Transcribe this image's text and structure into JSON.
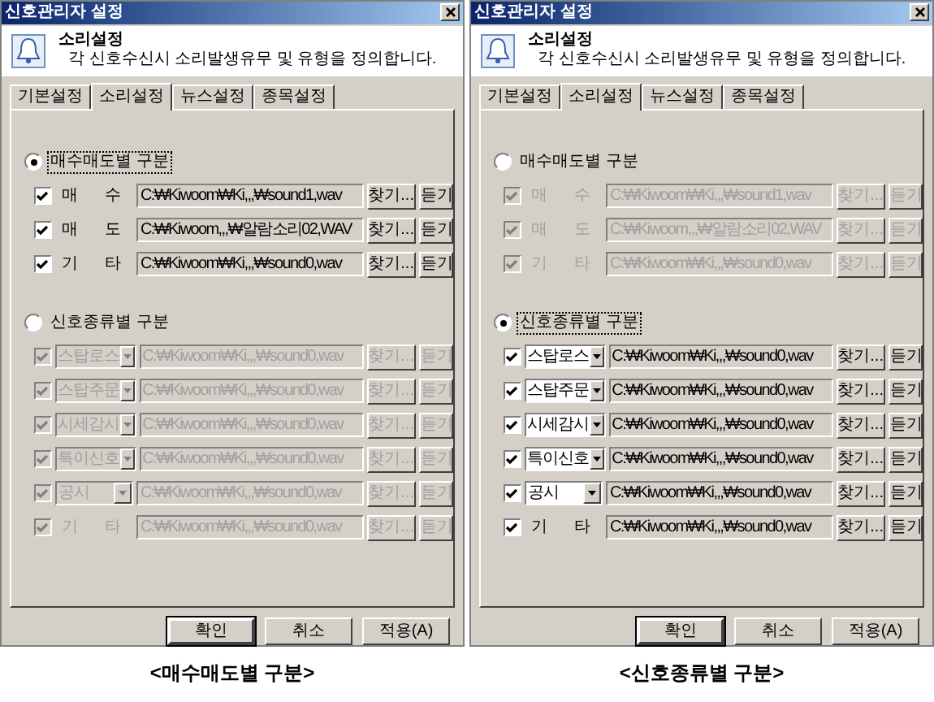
{
  "dialogs": [
    {
      "title": "신호관리자 설정",
      "header": {
        "title": "소리설정",
        "description": "각 신호수신시 소리발생유무 및 유형을 정의합니다."
      },
      "tabs": [
        {
          "label": "기본설정",
          "selected": false
        },
        {
          "label": "소리설정",
          "selected": true
        },
        {
          "label": "뉴스설정",
          "selected": false
        },
        {
          "label": "종목설정",
          "selected": false
        }
      ],
      "groups": [
        {
          "label": "매수매도별 구분",
          "selected": true,
          "rows": [
            {
              "kind": "label",
              "label": "매 수",
              "checked": true,
              "path": "C:₩Kiwoom₩Ki,,,₩sound1,wav",
              "browse": "찾기...",
              "play": "듣기"
            },
            {
              "kind": "label",
              "label": "매 도",
              "checked": true,
              "path": "C:₩Kiwoom,,,₩알람소리02,WAV",
              "browse": "찾기...",
              "play": "듣기"
            },
            {
              "kind": "label",
              "label": "기 타",
              "checked": true,
              "path": "C:₩Kiwoom₩Ki,,,₩sound0,wav",
              "browse": "찾기...",
              "play": "듣기"
            }
          ]
        },
        {
          "label": "신호종류별 구분",
          "selected": false,
          "rows": [
            {
              "kind": "dropdown",
              "label": "스탑로스",
              "checked": true,
              "path": "C:₩Kiwoom₩Ki,,,₩sound0,wav",
              "browse": "찾기...",
              "play": "듣기"
            },
            {
              "kind": "dropdown",
              "label": "스탑주문",
              "checked": true,
              "path": "C:₩Kiwoom₩Ki,,,₩sound0,wav",
              "browse": "찾기...",
              "play": "듣기"
            },
            {
              "kind": "dropdown",
              "label": "시세감시",
              "checked": true,
              "path": "C:₩Kiwoom₩Ki,,,₩sound0,wav",
              "browse": "찾기...",
              "play": "듣기"
            },
            {
              "kind": "dropdown",
              "label": "특이신호",
              "checked": true,
              "path": "C:₩Kiwoom₩Ki,,,₩sound0,wav",
              "browse": "찾기...",
              "play": "듣기"
            },
            {
              "kind": "dropdown",
              "label": "공시",
              "checked": true,
              "path": "C:₩Kiwoom₩Ki,,,₩sound0,wav",
              "browse": "찾기...",
              "play": "듣기"
            },
            {
              "kind": "label",
              "label": "기 타",
              "checked": true,
              "path": "C:₩Kiwoom₩Ki,,,₩sound0,wav",
              "browse": "찾기...",
              "play": "듣기"
            }
          ]
        }
      ],
      "buttons": [
        {
          "label": "확인",
          "default": true
        },
        {
          "label": "취소",
          "default": false
        },
        {
          "label": "적용(A)",
          "default": false
        }
      ],
      "caption": "<매수매도별 구분>"
    },
    {
      "title": "신호관리자 설정",
      "header": {
        "title": "소리설정",
        "description": "각 신호수신시 소리발생유무 및 유형을 정의합니다."
      },
      "tabs": [
        {
          "label": "기본설정",
          "selected": false
        },
        {
          "label": "소리설정",
          "selected": true
        },
        {
          "label": "뉴스설정",
          "selected": false
        },
        {
          "label": "종목설정",
          "selected": false
        }
      ],
      "groups": [
        {
          "label": "매수매도별 구분",
          "selected": false,
          "rows": [
            {
              "kind": "label",
              "label": "매 수",
              "checked": true,
              "path": "C:₩Kiwoom₩Ki,,,₩sound1,wav",
              "browse": "찾기...",
              "play": "듣기"
            },
            {
              "kind": "label",
              "label": "매 도",
              "checked": true,
              "path": "C:₩Kiwoom,,,₩알람소리02,WAV",
              "browse": "찾기...",
              "play": "듣기"
            },
            {
              "kind": "label",
              "label": "기 타",
              "checked": true,
              "path": "C:₩Kiwoom₩Ki,,,₩sound0,wav",
              "browse": "찾기...",
              "play": "듣기"
            }
          ]
        },
        {
          "label": "신호종류별 구분",
          "selected": true,
          "rows": [
            {
              "kind": "dropdown",
              "label": "스탑로스",
              "checked": true,
              "path": "C:₩Kiwoom₩Ki,,,₩sound0,wav",
              "browse": "찾기...",
              "play": "듣기"
            },
            {
              "kind": "dropdown",
              "label": "스탑주문",
              "checked": true,
              "path": "C:₩Kiwoom₩Ki,,,₩sound0,wav",
              "browse": "찾기...",
              "play": "듣기"
            },
            {
              "kind": "dropdown",
              "label": "시세감시",
              "checked": true,
              "path": "C:₩Kiwoom₩Ki,,,₩sound0,wav",
              "browse": "찾기...",
              "play": "듣기"
            },
            {
              "kind": "dropdown",
              "label": "특이신호",
              "checked": true,
              "path": "C:₩Kiwoom₩Ki,,,₩sound0,wav",
              "browse": "찾기...",
              "play": "듣기"
            },
            {
              "kind": "dropdown",
              "label": "공시",
              "checked": true,
              "path": "C:₩Kiwoom₩Ki,,,₩sound0,wav",
              "browse": "찾기...",
              "play": "듣기"
            },
            {
              "kind": "label",
              "label": "기 타",
              "checked": true,
              "path": "C:₩Kiwoom₩Ki,,,₩sound0,wav",
              "browse": "찾기...",
              "play": "듣기"
            }
          ]
        }
      ],
      "buttons": [
        {
          "label": "확인",
          "default": true
        },
        {
          "label": "취소",
          "default": false
        },
        {
          "label": "적용(A)",
          "default": false
        }
      ],
      "caption": "<신호종류별 구분>"
    }
  ]
}
